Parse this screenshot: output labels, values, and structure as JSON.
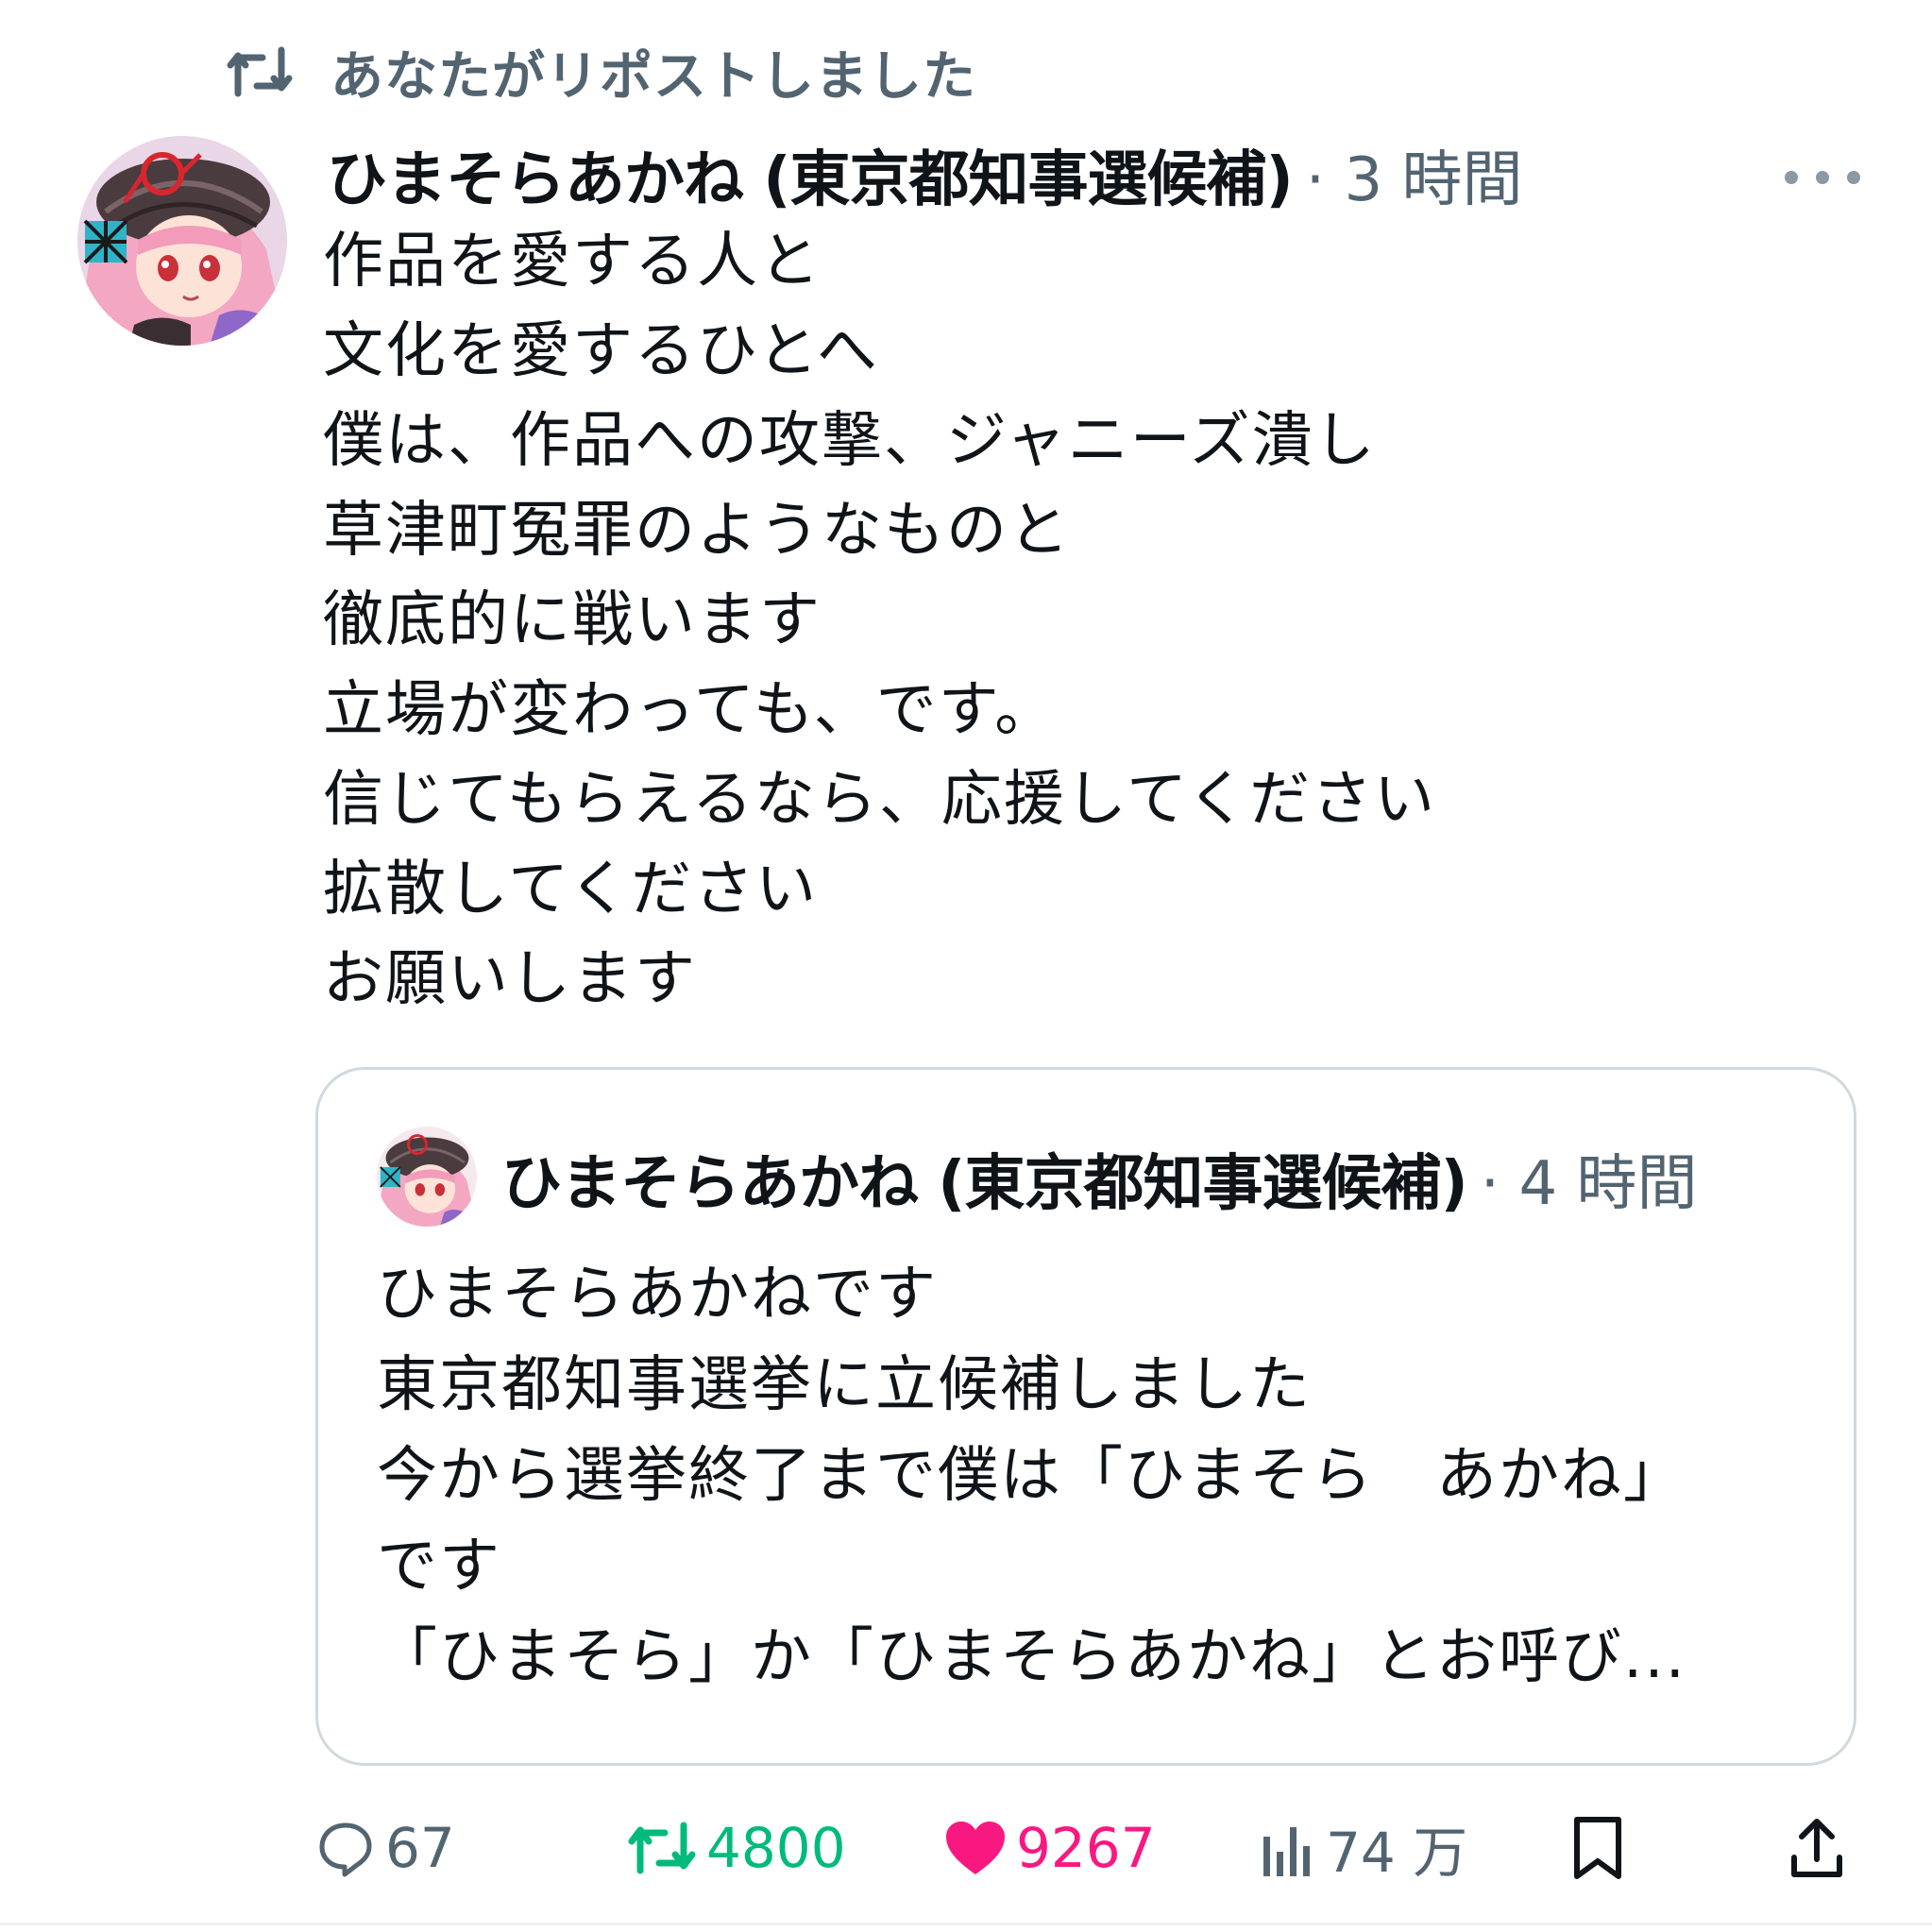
{
  "repost_header": {
    "icon": "repost-icon",
    "text": "あなたがリポストしました"
  },
  "tweet": {
    "author_name": "ひまそらあかね (東京都知事選候補)",
    "time": "· 3 時間",
    "more_icon": "more-dots-icon",
    "lines": [
      "作品を愛する人と",
      "文化を愛するひとへ",
      "僕は、作品への攻撃、ジャニーズ潰し",
      "草津町冤罪のようなものと",
      "徹底的に戦います",
      "立場が変わっても、です。",
      "信じてもらえるなら、応援してください",
      "拡散してください",
      "お願いします"
    ]
  },
  "quote": {
    "author_name": "ひまそらあかね (東京都知事選候補)",
    "time": "· 4 時間",
    "lines": [
      "ひまそらあかねです",
      "東京都知事選挙に立候補しました",
      "今から選挙終了まで僕は「ひまそら　あかね」",
      "です",
      "「ひまそら」か「ひまそらあかね」とお呼び..."
    ]
  },
  "actions": {
    "reply": {
      "icon": "reply-icon",
      "count": "67"
    },
    "retweet": {
      "icon": "retweet-icon",
      "count": "4800",
      "color": "#00ba7c"
    },
    "like": {
      "icon": "heart-icon",
      "count": "9267",
      "color": "#f91880"
    },
    "views": {
      "icon": "analytics-icon",
      "count": "74 万"
    },
    "bookmark": {
      "icon": "bookmark-icon"
    },
    "share": {
      "icon": "share-icon"
    }
  }
}
